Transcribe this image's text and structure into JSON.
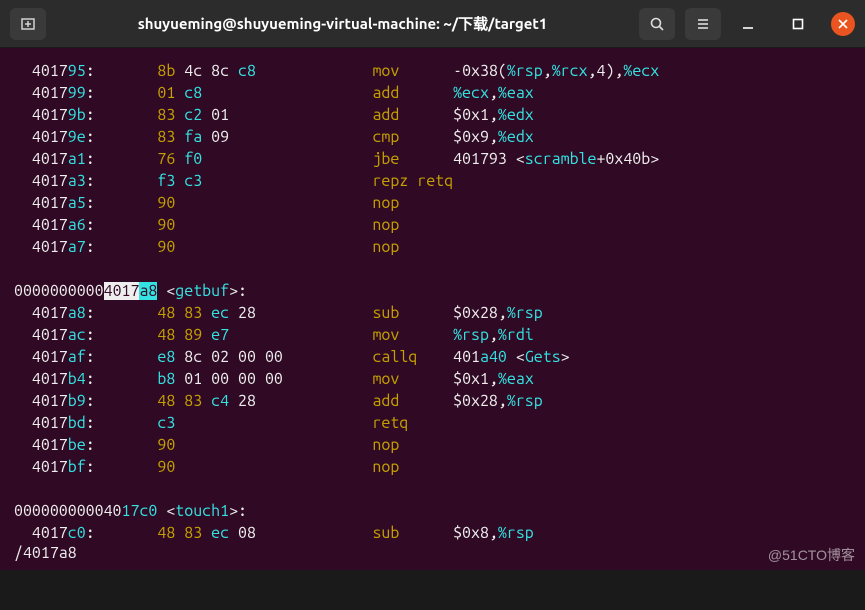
{
  "titlebar": {
    "title": "shuyueming@shuyueming-virtual-machine: ~/下载/target1"
  },
  "search_line": "/4017a8",
  "watermark": "@51CTO博客",
  "lines": [
    {
      "addr": "401795",
      "bytes": [
        "8b",
        "4c",
        "8c",
        "c8"
      ],
      "byte_colors": [
        "y",
        "w",
        "w",
        "r"
      ],
      "mn": "mov",
      "opd": [
        {
          "t": "lit",
          "v": "-0x38("
        },
        {
          "t": "reg",
          "v": "%rsp"
        },
        {
          "t": "lit",
          "v": ","
        },
        {
          "t": "reg",
          "v": "%rcx"
        },
        {
          "t": "lit",
          "v": ",4),"
        },
        {
          "t": "reg",
          "v": "%ecx"
        }
      ]
    },
    {
      "addr": "401799",
      "bytes": [
        "01",
        "c8"
      ],
      "byte_colors": [
        "y",
        "r"
      ],
      "mn": "add",
      "opd": [
        {
          "t": "reg",
          "v": "%ecx"
        },
        {
          "t": "lit",
          "v": ","
        },
        {
          "t": "reg",
          "v": "%eax"
        }
      ]
    },
    {
      "addr": "40179b",
      "bytes": [
        "83",
        "c2",
        "01"
      ],
      "byte_colors": [
        "y",
        "r",
        "w"
      ],
      "mn": "add",
      "opd": [
        {
          "t": "lit",
          "v": "$0x1,"
        },
        {
          "t": "reg",
          "v": "%edx"
        }
      ]
    },
    {
      "addr": "40179e",
      "bytes": [
        "83",
        "fa",
        "09"
      ],
      "byte_colors": [
        "y",
        "r",
        "w"
      ],
      "mn": "cmp",
      "opd": [
        {
          "t": "lit",
          "v": "$0x9,"
        },
        {
          "t": "reg",
          "v": "%edx"
        }
      ]
    },
    {
      "addr": "4017a1",
      "bytes": [
        "76",
        "f0"
      ],
      "byte_colors": [
        "y",
        "r"
      ],
      "mn": "jbe",
      "opd": [
        {
          "t": "lit",
          "v": "401793 <"
        },
        {
          "t": "sym",
          "v": "scramble"
        },
        {
          "t": "lit",
          "v": "+0x40b>"
        }
      ]
    },
    {
      "addr": "4017a3",
      "bytes": [
        "f3",
        "c3"
      ],
      "byte_colors": [
        "r",
        "r"
      ],
      "mn": "repz",
      "mn2": "retq",
      "opd": []
    },
    {
      "addr": "4017a5",
      "bytes": [
        "90"
      ],
      "byte_colors": [
        "y"
      ],
      "mn": "nop",
      "opd": []
    },
    {
      "addr": "4017a6",
      "bytes": [
        "90"
      ],
      "byte_colors": [
        "y"
      ],
      "mn": "nop",
      "opd": []
    },
    {
      "addr": "4017a7",
      "bytes": [
        "90"
      ],
      "byte_colors": [
        "y"
      ],
      "mn": "nop",
      "opd": []
    }
  ],
  "label1": {
    "full_addr": "00000000004017a8",
    "highlight_start": 10,
    "highlight_mid": 14,
    "name": "getbuf"
  },
  "lines2": [
    {
      "addr": "4017a8",
      "bytes": [
        "48",
        "83",
        "ec",
        "28"
      ],
      "byte_colors": [
        "y",
        "y",
        "r",
        "w"
      ],
      "mn": "sub",
      "opd": [
        {
          "t": "lit",
          "v": "$0x28,"
        },
        {
          "t": "reg",
          "v": "%rsp"
        }
      ]
    },
    {
      "addr": "4017ac",
      "bytes": [
        "48",
        "89",
        "e7"
      ],
      "byte_colors": [
        "y",
        "y",
        "r"
      ],
      "mn": "mov",
      "opd": [
        {
          "t": "reg",
          "v": "%rsp"
        },
        {
          "t": "lit",
          "v": ","
        },
        {
          "t": "reg",
          "v": "%rdi"
        }
      ]
    },
    {
      "addr": "4017af",
      "bytes": [
        "e8",
        "8c",
        "02",
        "00",
        "00"
      ],
      "byte_colors": [
        "r",
        "w",
        "w",
        "w",
        "w"
      ],
      "mn": "callq",
      "opd": [
        {
          "t": "lit",
          "v": "401"
        },
        {
          "t": "sym",
          "v": "a40"
        },
        {
          "t": "lit",
          "v": " <"
        },
        {
          "t": "sym",
          "v": "Gets"
        },
        {
          "t": "lit",
          "v": ">"
        }
      ]
    },
    {
      "addr": "4017b4",
      "bytes": [
        "b8",
        "01",
        "00",
        "00",
        "00"
      ],
      "byte_colors": [
        "r",
        "w",
        "w",
        "w",
        "w"
      ],
      "mn": "mov",
      "opd": [
        {
          "t": "lit",
          "v": "$0x1,"
        },
        {
          "t": "reg",
          "v": "%eax"
        }
      ]
    },
    {
      "addr": "4017b9",
      "bytes": [
        "48",
        "83",
        "c4",
        "28"
      ],
      "byte_colors": [
        "y",
        "y",
        "r",
        "w"
      ],
      "mn": "add",
      "opd": [
        {
          "t": "lit",
          "v": "$0x28,"
        },
        {
          "t": "reg",
          "v": "%rsp"
        }
      ]
    },
    {
      "addr": "4017bd",
      "bytes": [
        "c3"
      ],
      "byte_colors": [
        "r"
      ],
      "mn": "retq",
      "opd": []
    },
    {
      "addr": "4017be",
      "bytes": [
        "90"
      ],
      "byte_colors": [
        "y"
      ],
      "mn": "nop",
      "opd": []
    },
    {
      "addr": "4017bf",
      "bytes": [
        "90"
      ],
      "byte_colors": [
        "y"
      ],
      "mn": "nop",
      "opd": []
    }
  ],
  "label2": {
    "full_addr": "00000000004017c0",
    "name": "touch1"
  },
  "lines3": [
    {
      "addr": "4017c0",
      "bytes": [
        "48",
        "83",
        "ec",
        "08"
      ],
      "byte_colors": [
        "y",
        "y",
        "r",
        "w"
      ],
      "mn": "sub",
      "opd": [
        {
          "t": "lit",
          "v": "$0x8,"
        },
        {
          "t": "reg",
          "v": "%rsp"
        }
      ]
    }
  ]
}
